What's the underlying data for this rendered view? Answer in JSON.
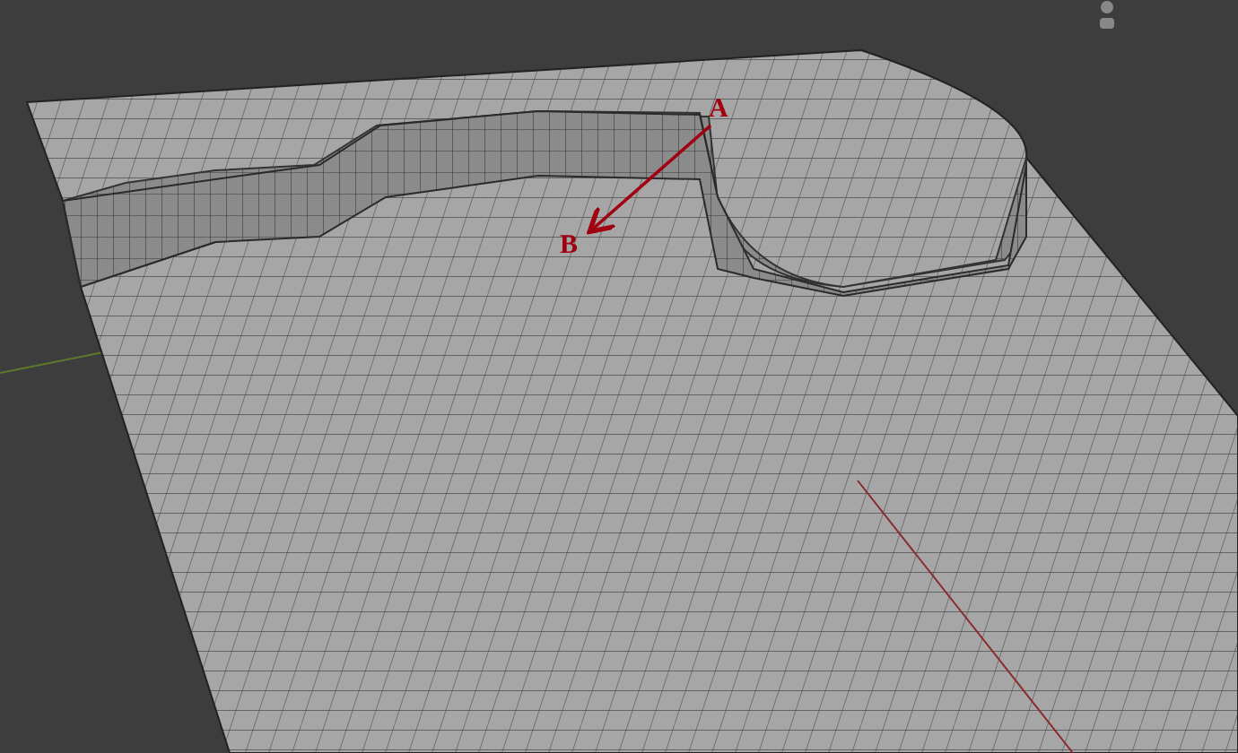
{
  "viewport": {
    "labels": [
      {
        "text": "A"
      },
      {
        "text": "B"
      }
    ]
  }
}
